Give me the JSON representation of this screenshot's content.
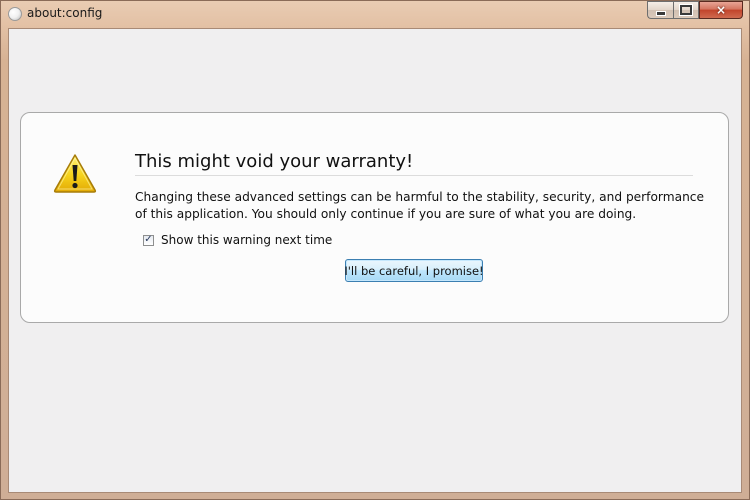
{
  "window": {
    "title": "about:config",
    "controls": {
      "minimize": "minimize",
      "maximize": "maximize",
      "close": "×"
    }
  },
  "warning": {
    "icon": "warning-triangle-icon",
    "heading": "This might void your warranty!",
    "message": "Changing these advanced settings can be harmful to the stability, security, and performance of this application. You should only continue if you are sure of what you are doing.",
    "checkbox": {
      "label": "Show this warning next time",
      "checked": true,
      "mark": "✓"
    },
    "button_label": "I'll be careful, I promise!"
  },
  "colors": {
    "accent": "#3c7fb1",
    "warning_yellow": "#f2cc0c",
    "client_background": "#f0eff0"
  }
}
